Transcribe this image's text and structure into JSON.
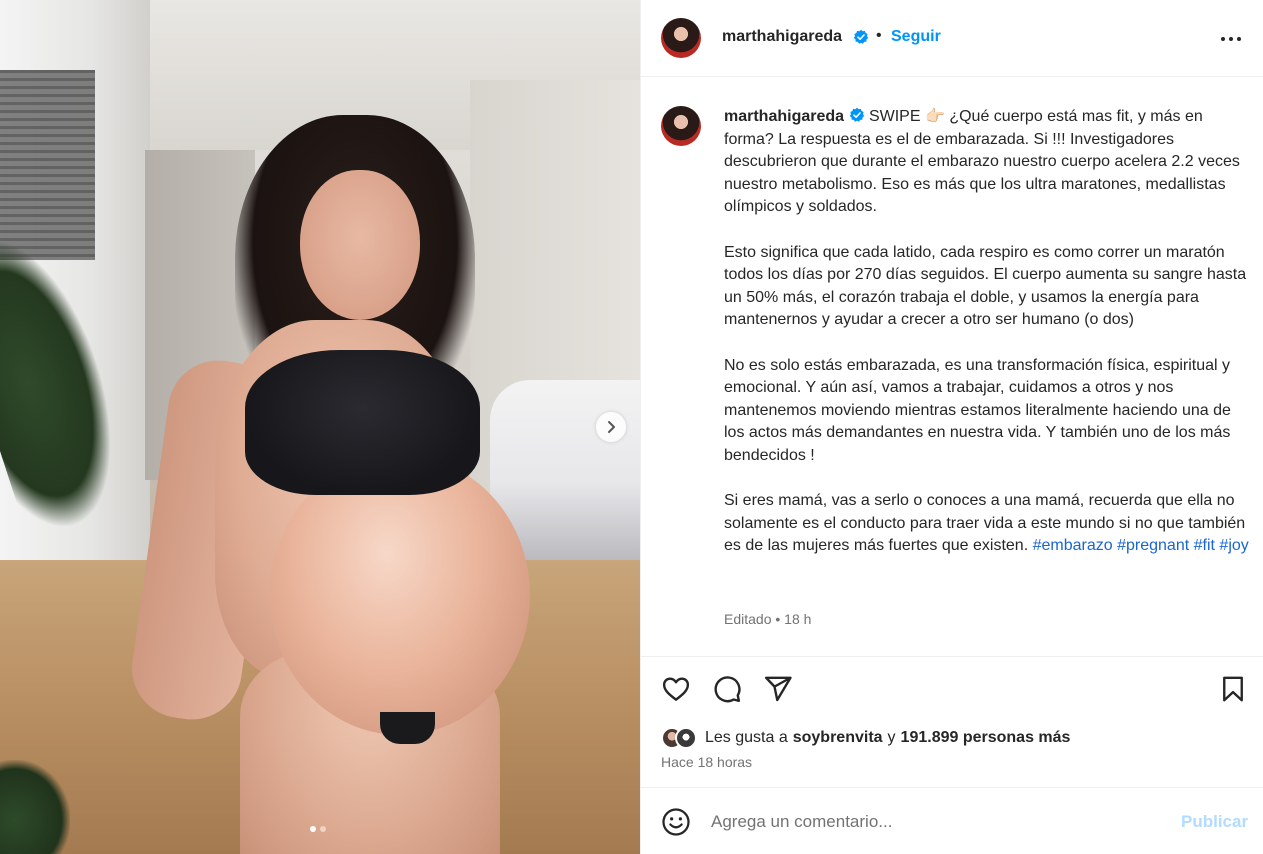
{
  "post": {
    "username": "marthahigareda",
    "follow_label": "Seguir",
    "separator": "•",
    "caption_user": "marthahigareda",
    "caption_paragraphs": [
      "SWIPE 👉🏻 ¿Qué cuerpo está mas fit, y más en forma? La respuesta es el de embarazada. Si !!! Investigadores descubrieron que durante el embarazo nuestro cuerpo acelera 2.2 veces nuestro metabolismo. Eso es más que los ultra maratones, medallistas olímpicos y soldados.",
      "Esto significa que cada latido, cada respiro es como correr un maratón todos los días por 270 días seguidos. El cuerpo aumenta su sangre hasta un 50% más, el corazón trabaja el doble, y usamos la energía para mantenernos y ayudar a crecer a otro ser humano (o dos)",
      "No es solo estás embarazada, es una transformación física, espiritual y emocional. Y aún así, vamos a trabajar, cuidamos a otros y nos mantenemos moviendo mientras estamos literalmente haciendo una de los actos más demandantes en nuestra vida. Y también uno de los más bendecidos !",
      "Si eres mamá, vas a serlo o conoces a una mamá, recuerda que ella no solamente es el conducto para traer vida a este mundo si no que también es de las mujeres más fuertes que existen."
    ],
    "hashtags": [
      "#embarazo",
      "#pregnant",
      "#fit",
      "#joy"
    ],
    "edited_label": "Editado",
    "edited_time": "18 h",
    "likes_prefix": "Les gusta a",
    "likes_user": "soybrenvita",
    "likes_conjunction": "y",
    "likes_rest": "191.899 personas más",
    "posted_time": "Hace 18 horas",
    "comment_placeholder": "Agrega un comentario...",
    "publish_label": "Publicar",
    "carousel": {
      "total": 2,
      "current": 1
    }
  },
  "icons": {
    "verified": "verified-badge-icon",
    "more": "more-options-icon",
    "like": "heart-icon",
    "comment": "comment-icon",
    "share": "share-icon",
    "save": "bookmark-icon",
    "emoji": "emoji-icon",
    "next": "chevron-right-icon"
  },
  "colors": {
    "accent": "#0095f6",
    "hashtag": "#1a66d0",
    "muted": "#737373",
    "publish_disabled": "#b3dbff",
    "verified": "#0095f6"
  }
}
